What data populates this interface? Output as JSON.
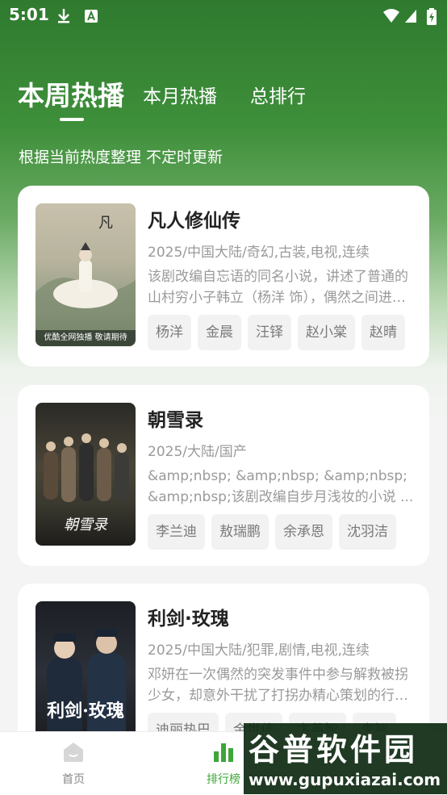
{
  "status_bar": {
    "time": "5:01"
  },
  "tabs": [
    {
      "label": "本周热播"
    },
    {
      "label": "本月热播"
    },
    {
      "label": "总排行"
    }
  ],
  "subtitle": "根据当前热度整理 不定时更新",
  "cards": [
    {
      "title": "凡人修仙传",
      "meta": "2025/中国大陆/奇幻,古装,电视,连续",
      "desc": "该剧改编自忘语的同名小说，讲述了普通的山村穷小子韩立（杨洋 饰），偶然之间进入江湖小门派，成为一名记名弟子，后来开始了修仙之路。",
      "poster_caption": "优酷全网独播 敬请期待",
      "tags": [
        "杨洋",
        "金晨",
        "汪铎",
        "赵小棠",
        "赵晴"
      ]
    },
    {
      "title": "朝雪录",
      "meta": "2025/大陆/国产",
      "desc": "&amp;nbsp; &amp;nbsp; &amp;nbsp; &amp;nbsp;该剧改编自步月浅妆的小说 ...",
      "poster_caption": "朝雪录",
      "tags": [
        "李兰迪",
        "敖瑞鹏",
        "余承恩",
        "沈羽洁"
      ]
    },
    {
      "title": "利剑·玫瑰",
      "meta": "2025/中国大陆/犯罪,剧情,电视,连续",
      "desc": "邓妍在一次偶然的突发事件中参与解救被拐少女，却意外干扰了打拐办精心策划的行动。",
      "poster_caption": "利剑·玫瑰",
      "tags": [
        "迪丽热巴",
        "金世佳",
        "卞英智",
        "李智"
      ]
    }
  ],
  "bottom_nav": [
    {
      "label": "首页",
      "icon": "home-icon",
      "active": false
    },
    {
      "label": "排行榜",
      "icon": "chart-icon",
      "active": true
    }
  ],
  "watermark": {
    "big": "谷普软件园",
    "small": "www.gupuxiazai.com"
  },
  "colors": {
    "accent": "#3ea63a",
    "header_green": "#2f7a2f"
  }
}
